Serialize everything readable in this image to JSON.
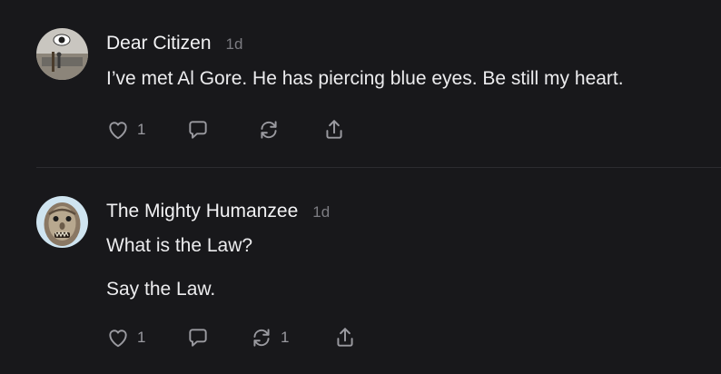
{
  "comments": [
    {
      "author": "Dear Citizen",
      "time": "1d",
      "paragraphs": [
        "I’ve met Al Gore. He has piercing blue eyes. Be still my heart."
      ],
      "likes": "1",
      "restacks": ""
    },
    {
      "author": "The Mighty Humanzee",
      "time": "1d",
      "paragraphs": [
        "What is the Law?",
        "Say the Law."
      ],
      "likes": "1",
      "restacks": "1"
    }
  ],
  "icons": {
    "like": "heart-icon",
    "reply": "comment-bubble-icon",
    "restack": "restack-icon",
    "share": "share-icon"
  },
  "colors": {
    "background": "#18181b",
    "text": "#ececee",
    "muted": "#7c7c82",
    "icon": "#9a9aa0"
  }
}
